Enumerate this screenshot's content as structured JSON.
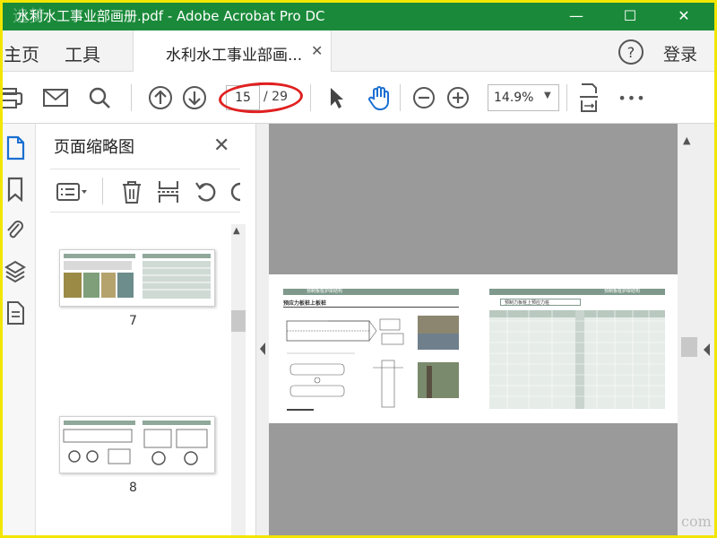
{
  "window": {
    "title": "水利水工事业部画册.pdf - Adobe Acrobat Pro DC",
    "min_glyph": "—",
    "max_glyph": "☐",
    "close_glyph": "✕",
    "overlay_text": "追梦"
  },
  "tabs": {
    "home": "主页",
    "tools": "工具",
    "document": "水利水工事业部画...",
    "close_glyph": "✕",
    "help_glyph": "?",
    "login": "登录"
  },
  "toolbar": {
    "current_page": "15",
    "page_total": "/ 29",
    "zoom": "14.9%",
    "zoom_arrow": "▼",
    "more_glyph": "•••"
  },
  "thumbnails": {
    "title": "页面缩略图",
    "close_glyph": "✕",
    "pages": [
      {
        "number": "7"
      },
      {
        "number": "8"
      }
    ]
  },
  "document_page": {
    "left_heading": "预制板桩护岸结构",
    "left_subheading": "预应力板桩上板桩",
    "right_heading": "预制板桩护岸结构",
    "right_subheading": "预制力板桩上预应力桩"
  },
  "footer_watermark": "com",
  "colors": {
    "titlebar": "#1a8a3a",
    "frame": "#f2e600",
    "accent_blue": "#1a6fd1",
    "annotation_red": "#e02020",
    "doc_background": "#9a9a9a"
  },
  "icons": [
    "print-icon",
    "mail-icon",
    "search-icon",
    "page-up-icon",
    "page-down-icon",
    "select-arrow-icon",
    "hand-icon",
    "zoom-out-icon",
    "zoom-in-icon",
    "fit-page-icon",
    "more-icon"
  ]
}
